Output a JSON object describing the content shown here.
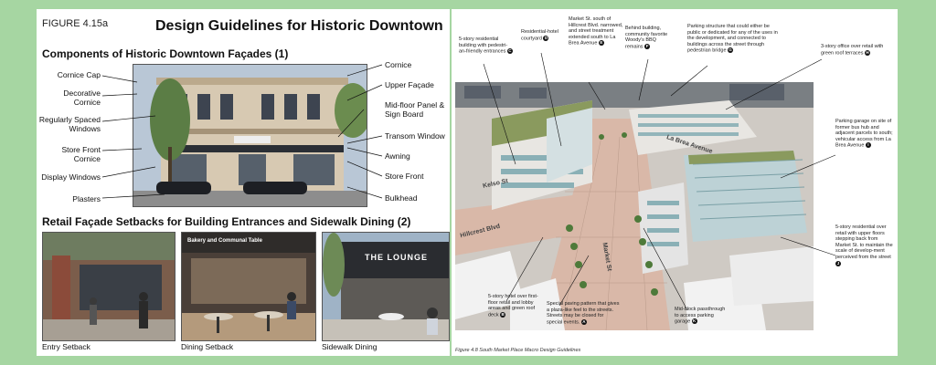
{
  "left": {
    "figure_label": "FIGURE 4.15a",
    "title": "Design Guidelines for Historic Downtown",
    "section1_title": "Components of Historic Downtown Façades (1)",
    "labels_left": [
      "Cornice Cap",
      "Decorative Cornice",
      "Regularly Spaced Windows",
      "Store Front Cornice",
      "Display Windows",
      "Plasters"
    ],
    "labels_right": [
      "Cornice",
      "Upper Façade",
      "Mid-floor Panel & Sign Board",
      "Transom Window",
      "Awning",
      "Store Front",
      "Bulkhead"
    ],
    "section2_title": "Retail Façade Setbacks for Building Entrances and Sidewalk Dining (2)",
    "captions": [
      "Entry Setback",
      "Dining Setback",
      "Sidewalk Dining"
    ],
    "sign_cafe": "Bakery and Communal Table",
    "sign_lounge": "THE LOUNGE"
  },
  "right": {
    "annotations": [
      {
        "text": "5-story residential building with pedestri-an-friendly entrances",
        "badge": "C"
      },
      {
        "text": "Residential-hotel courtyard",
        "badge": "D"
      },
      {
        "text": "Market St. south of Hillcrest Blvd. narrowed, and street treatment extended south to La Brea Avenue",
        "badge": "E"
      },
      {
        "text": "Behind building, community favorite Woody's BBQ remains",
        "badge": "F"
      },
      {
        "text": "Parking structure that could either be public or dedicated for any of the uses in the development, and connected to buildings across the street through pedestrian bridge",
        "badge": "G"
      },
      {
        "text": "3-story office over retail with green roof terraces",
        "badge": "H"
      },
      {
        "text": "Parking garage on site of former bus hub and adjacent parcels to south; vehicular access from La Brea Avenue",
        "badge": "I"
      },
      {
        "text": "5-story residential over retail with upper floors stepping back from Market St. to maintain the scale of develop-ment perceived from the street",
        "badge": "J"
      },
      {
        "text": "5-story hotel over first-floor retail and lobby areas and green roof deck",
        "badge": "B"
      },
      {
        "text": "Special paving pattern that gives a plaza-like feel to the streets. Streets may be closed for special events.",
        "badge": "A"
      },
      {
        "text": "Mid-block passthrough to access parking garage",
        "badge": "K"
      }
    ],
    "streets": [
      "Kelso St",
      "La Brea Avenue",
      "Hillcrest Blvd",
      "Market St"
    ],
    "figure_caption": "Figure 4.8 South Market Place Macro Design Guidelines"
  },
  "colors": {
    "background": "#a6d6a2",
    "page": "#ffffff",
    "building_glass": "#8ab0b6",
    "roof_green": "#8a9a5e",
    "plaza": "#d9b8a8"
  }
}
